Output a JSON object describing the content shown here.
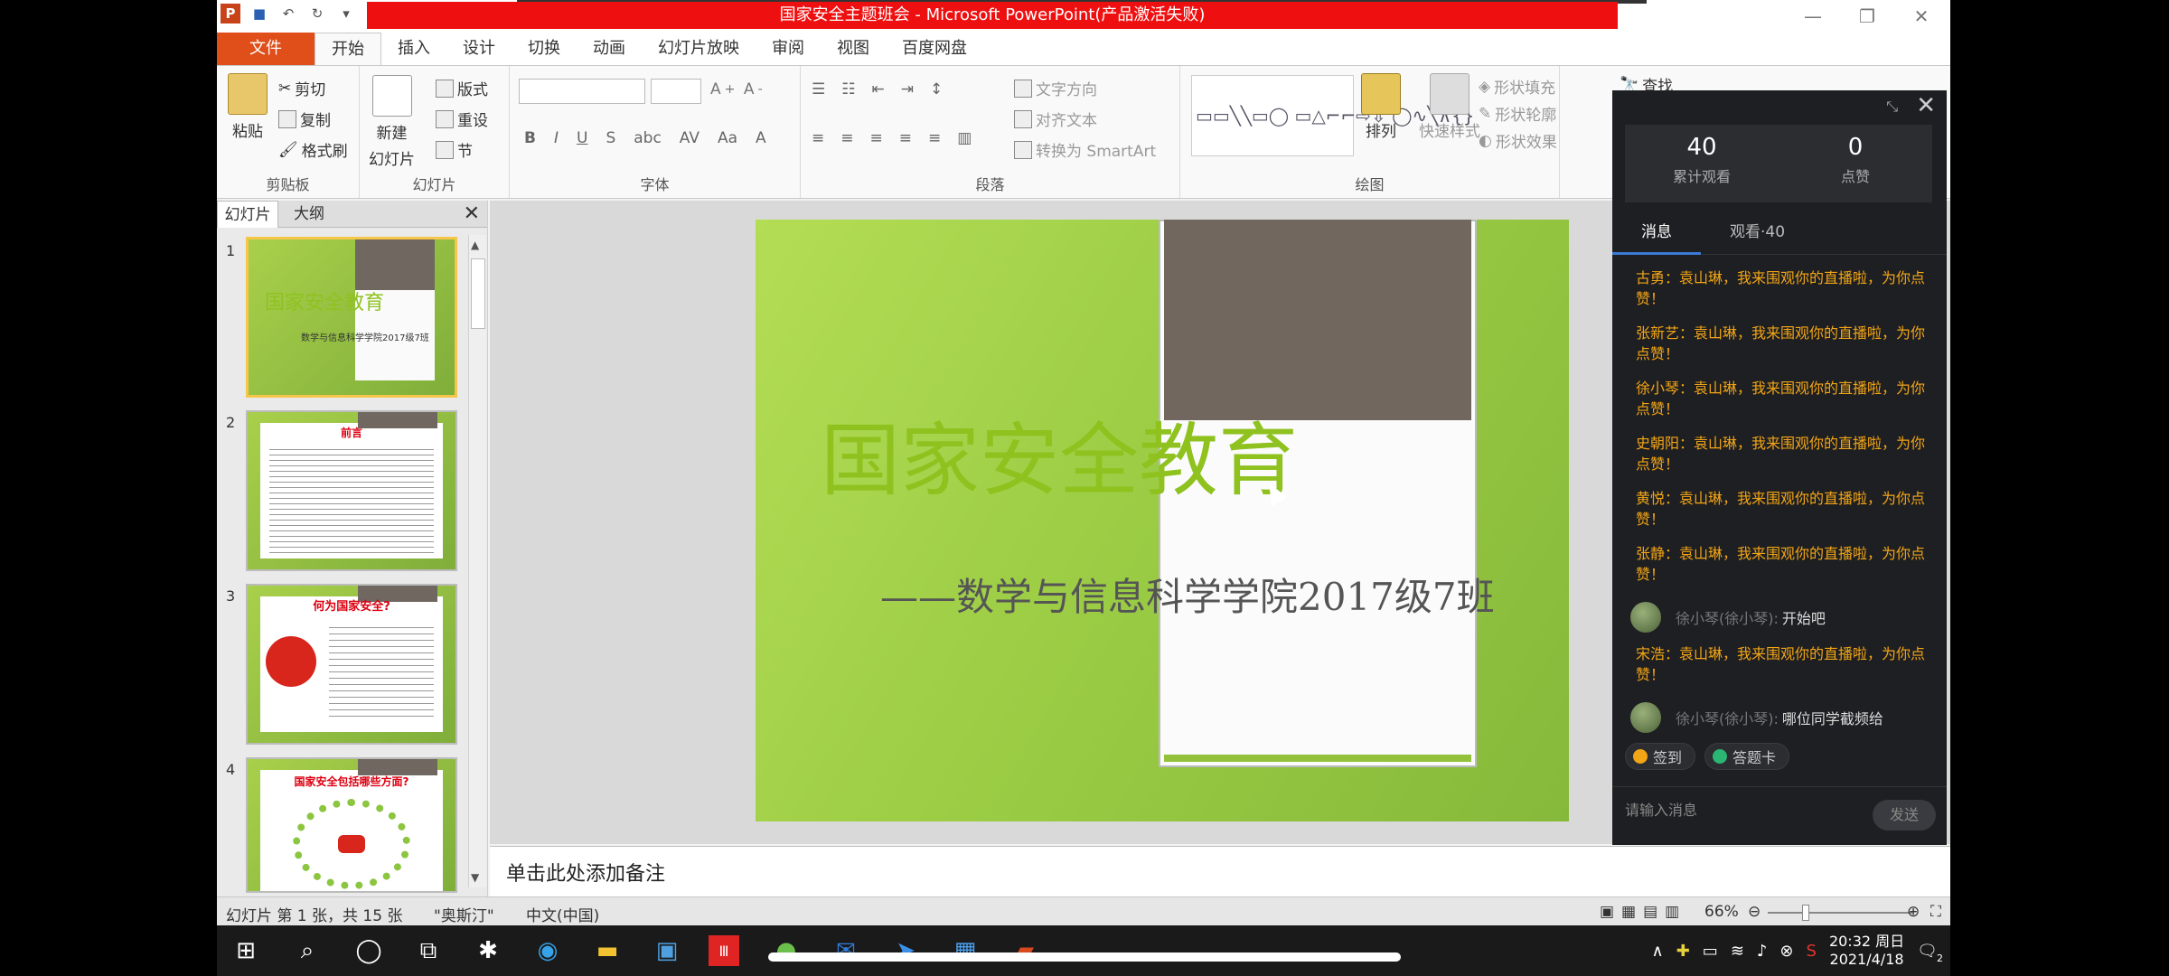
{
  "window": {
    "title": "国家安全主题班会 - Microsoft PowerPoint(产品激活失败)",
    "app_icon": "P"
  },
  "ribbon": {
    "tabs": [
      "文件",
      "开始",
      "插入",
      "设计",
      "切换",
      "动画",
      "幻灯片放映",
      "审阅",
      "视图",
      "百度网盘"
    ],
    "clipboard": {
      "paste": "粘贴",
      "cut": "剪切",
      "copy": "复制",
      "format_painter": "格式刷",
      "label": "剪贴板"
    },
    "slides": {
      "new_slide": "新建",
      "new_slide2": "幻灯片",
      "layout": "版式",
      "reset": "重设",
      "section": "节",
      "label": "幻灯片"
    },
    "font": {
      "label": "字体"
    },
    "paragraph": {
      "text_direction": "文字方向",
      "align_text": "对齐文本",
      "smartart": "转换为 SmartArt",
      "label": "段落"
    },
    "drawing": {
      "arrange": "排列",
      "quick_styles": "快速样式",
      "shape_fill": "形状填充",
      "shape_outline": "形状轮廓",
      "shape_effects": "形状效果",
      "label": "绘图"
    },
    "find": "查找"
  },
  "slides_pane": {
    "tabs": [
      "幻灯片",
      "大纲"
    ],
    "thumbnails": [
      {
        "num": "1",
        "title": "国家安全教育",
        "subtitle": "数学与信息科学学院2017级7班"
      },
      {
        "num": "2",
        "title": "前言"
      },
      {
        "num": "3",
        "title": "何为国家安全?"
      },
      {
        "num": "4",
        "title": "国家安全包括哪些方面?"
      }
    ]
  },
  "slide": {
    "title": "国家安全教育",
    "subtitle": "——数学与信息科学学院2017级7班"
  },
  "notes": {
    "placeholder": "单击此处添加备注"
  },
  "status": {
    "slide_info": "幻灯片 第 1 张，共 15 张",
    "theme": "\"奥斯汀\"",
    "language": "中文(中国)",
    "zoom": "66%"
  },
  "live_panel": {
    "views_total": "40",
    "views_label": "累计观看",
    "likes": "0",
    "likes_label": "点赞",
    "tabs": [
      "消息",
      "观看·40"
    ],
    "messages": [
      {
        "type": "sys",
        "text": "古勇：袁山琳，我来围观你的直播啦，为你点赞！"
      },
      {
        "type": "sys",
        "text": "张新艺：袁山琳，我来围观你的直播啦，为你点赞！"
      },
      {
        "type": "sys",
        "text": "徐小琴：袁山琳，我来围观你的直播啦，为你点赞！"
      },
      {
        "type": "sys",
        "text": "史朝阳：袁山琳，我来围观你的直播啦，为你点赞！"
      },
      {
        "type": "sys",
        "text": "黄悦：袁山琳，我来围观你的直播啦，为你点赞！"
      },
      {
        "type": "sys",
        "text": "张静：袁山琳，我来围观你的直播啦，为你点赞！"
      },
      {
        "type": "chat",
        "name": "徐小琴(徐小琴):",
        "text": "开始吧"
      },
      {
        "type": "sys",
        "text": "宋浩：袁山琳，我来围观你的直播啦，为你点赞！"
      },
      {
        "type": "chat",
        "name": "徐小琴(徐小琴):",
        "text": "哪位同学截频给"
      }
    ],
    "quick": [
      "签到",
      "答题卡"
    ],
    "input_placeholder": "请输入消息",
    "send": "发送"
  },
  "taskbar": {
    "time": "20:32 周日",
    "date": "2021/4/18",
    "notifications": "2"
  },
  "colors": {
    "title_bar_red": "#ee1010",
    "file_tab": "#e04e1a",
    "slide_green": "#9ccd45",
    "slide_title": "#8fc21f",
    "message_orange": "#f2a516"
  }
}
